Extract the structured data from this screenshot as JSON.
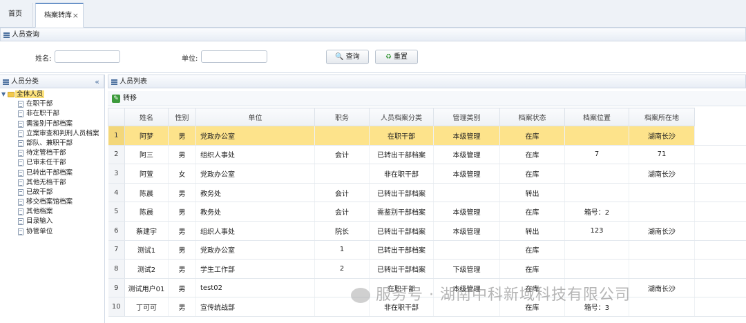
{
  "tabs": [
    {
      "label": "首页"
    },
    {
      "label": "档案转库",
      "close": "×"
    }
  ],
  "search_panel": {
    "title": "人员查询",
    "name_label": "姓名:",
    "name_value": "",
    "unit_label": "单位:",
    "unit_value": "",
    "query_button": "查询",
    "reset_button": "重置"
  },
  "category_panel": {
    "title": "人员分类",
    "collapse_icon": "«",
    "root": "全体人员",
    "items": [
      "在职干部",
      "非在职干部",
      "需鉴别干部档案",
      "立案审查和判刑人员档案",
      "部队、兼职干部",
      "待定管档干部",
      "已审未任干部",
      "已转出干部档案",
      "其他无档干部",
      "已故干部",
      "移交档案馆档案",
      "其他档案",
      "目录输入",
      "协管单位"
    ]
  },
  "list_panel": {
    "title": "人员列表",
    "move_button": "转移",
    "columns": [
      "",
      "姓名",
      "性别",
      "单位",
      "职务",
      "人员档案分类",
      "管理类别",
      "档案状态",
      "档案位置",
      "档案所在地"
    ],
    "rows": [
      [
        "1",
        "阿梦",
        "男",
        "党政办公室",
        "",
        "在职干部",
        "本级管理",
        "在库",
        "",
        "湖南长沙"
      ],
      [
        "2",
        "阿三",
        "男",
        "组织人事处",
        "会计",
        "已转出干部档案",
        "本级管理",
        "在库",
        "7",
        "71"
      ],
      [
        "3",
        "阿萱",
        "女",
        "党政办公室",
        "",
        "非在职干部",
        "本级管理",
        "在库",
        "",
        "湖南长沙"
      ],
      [
        "4",
        "陈晨",
        "男",
        "教务处",
        "会计",
        "已转出干部档案",
        "",
        "转出",
        "",
        ""
      ],
      [
        "5",
        "陈晨",
        "男",
        "教务处",
        "会计",
        "需鉴别干部档案",
        "本级管理",
        "在库",
        "箱号：2",
        ""
      ],
      [
        "6",
        "蔡建宇",
        "男",
        "组织人事处",
        "院长",
        "已转出干部档案",
        "本级管理",
        "转出",
        "123",
        "湖南长沙"
      ],
      [
        "7",
        "测试1",
        "男",
        "党政办公室",
        "1",
        "已转出干部档案",
        "",
        "在库",
        "",
        ""
      ],
      [
        "8",
        "测试2",
        "男",
        "学生工作部",
        "2",
        "已转出干部档案",
        "下级管理",
        "在库",
        "",
        ""
      ],
      [
        "9",
        "测试用户01",
        "男",
        "test02",
        "",
        "在职干部",
        "本级管理",
        "在库",
        "",
        "湖南长沙"
      ],
      [
        "10",
        "丁可可",
        "男",
        "宣传统战部",
        "",
        "非在职干部",
        "",
        "在库",
        "箱号：3",
        ""
      ]
    ],
    "selected_row": 0
  },
  "watermark": "服务号 · 湖南中科新域科技有限公司",
  "colors": {
    "selected_row": "#fde38b",
    "accent": "#4a6f9e"
  }
}
